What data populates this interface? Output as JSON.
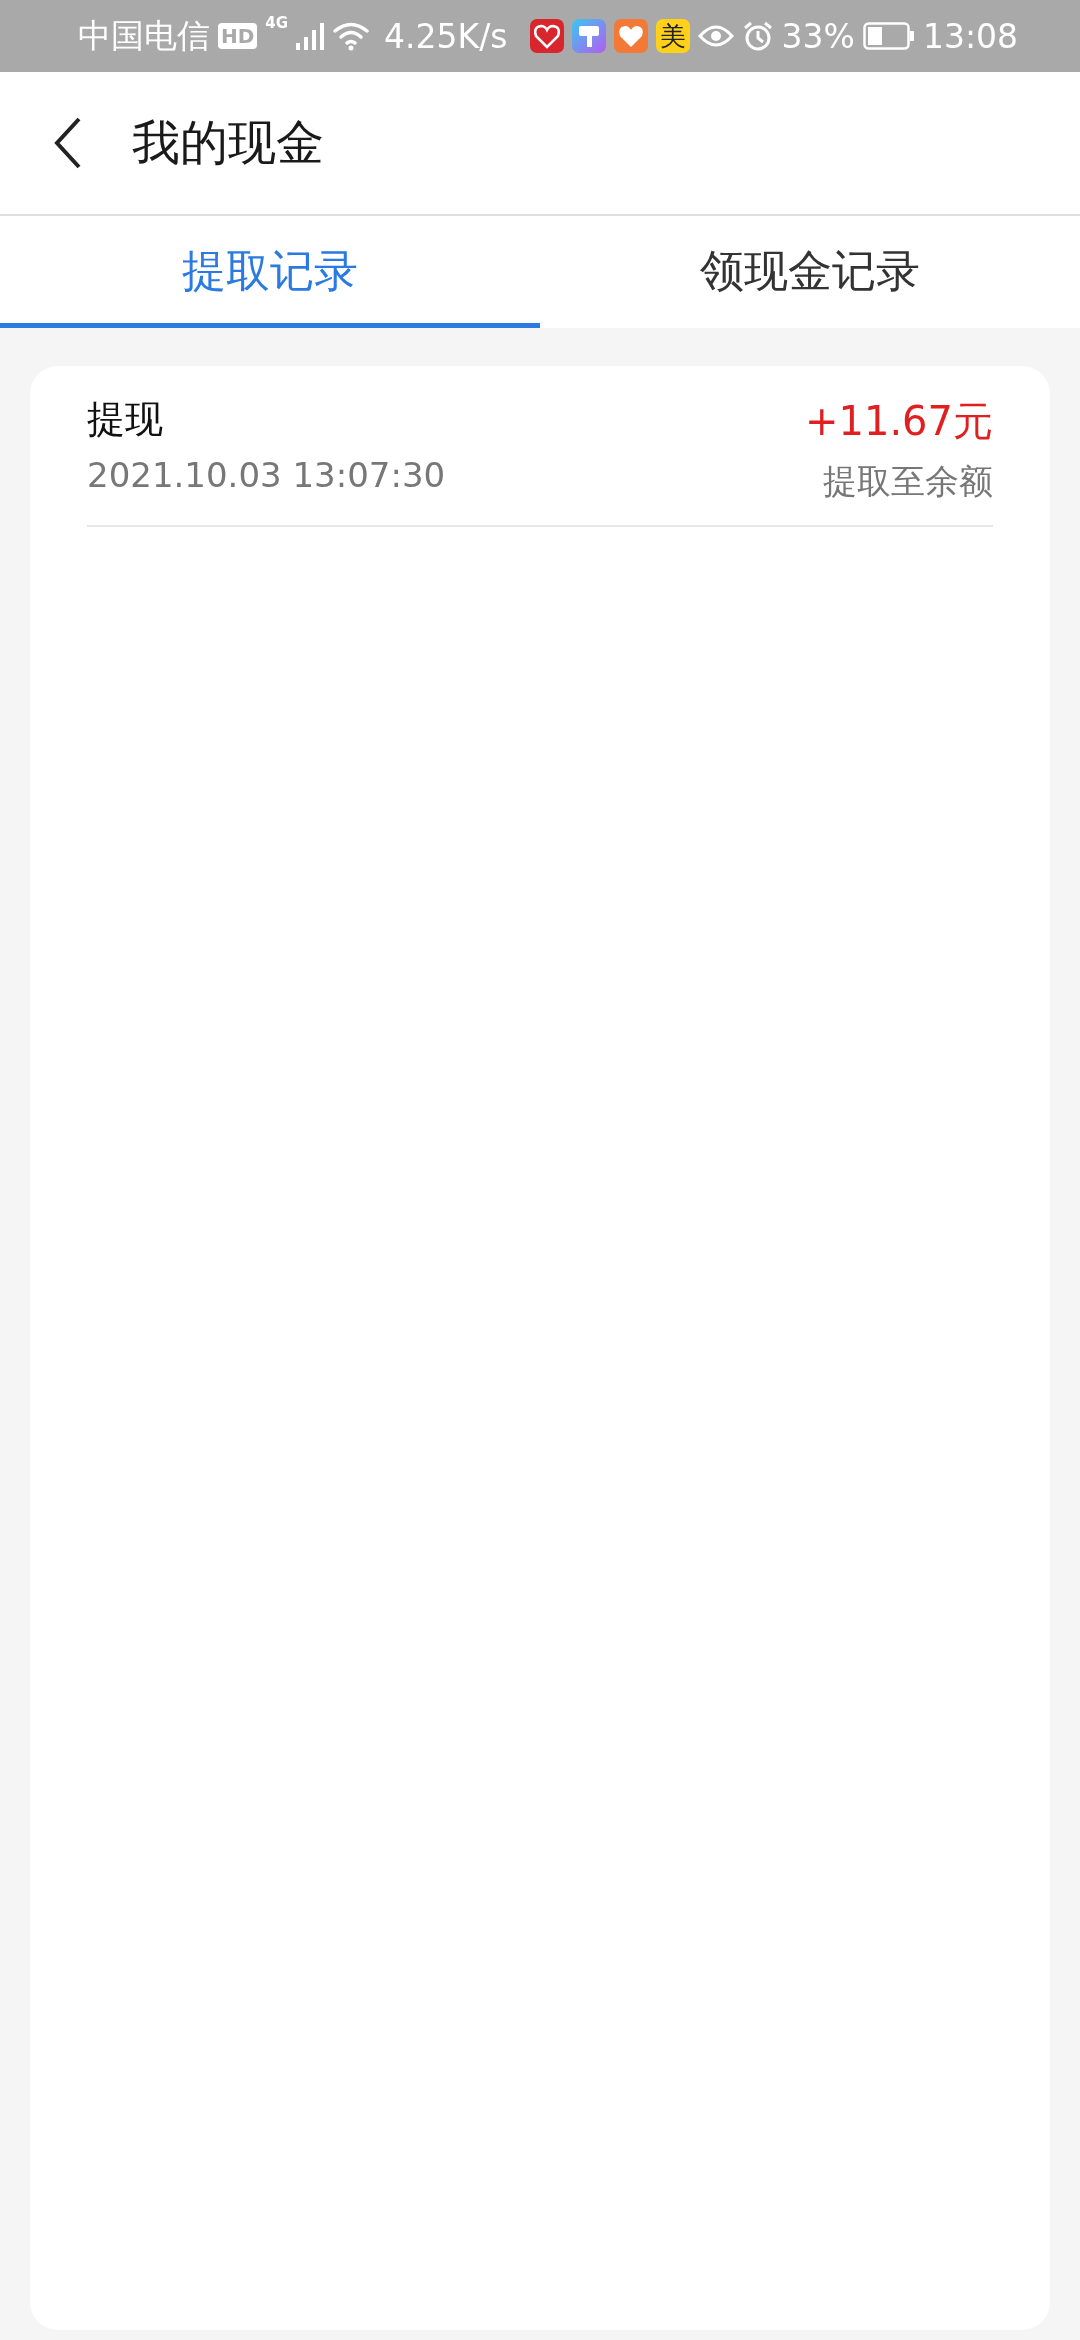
{
  "status_bar": {
    "carrier": "中国电信",
    "hd": "HD",
    "network": "4G",
    "speed": "4.25K/s",
    "app_badge": "美",
    "battery": "33%",
    "time": "13:08"
  },
  "header": {
    "title": "我的现金"
  },
  "tabs": [
    {
      "label": "提取记录",
      "selected": true
    },
    {
      "label": "领现金记录",
      "selected": false
    }
  ],
  "records": [
    {
      "title": "提现",
      "time": "2021.10.03 13:07:30",
      "amount": "+11.67元",
      "note": "提取至余额"
    }
  ]
}
